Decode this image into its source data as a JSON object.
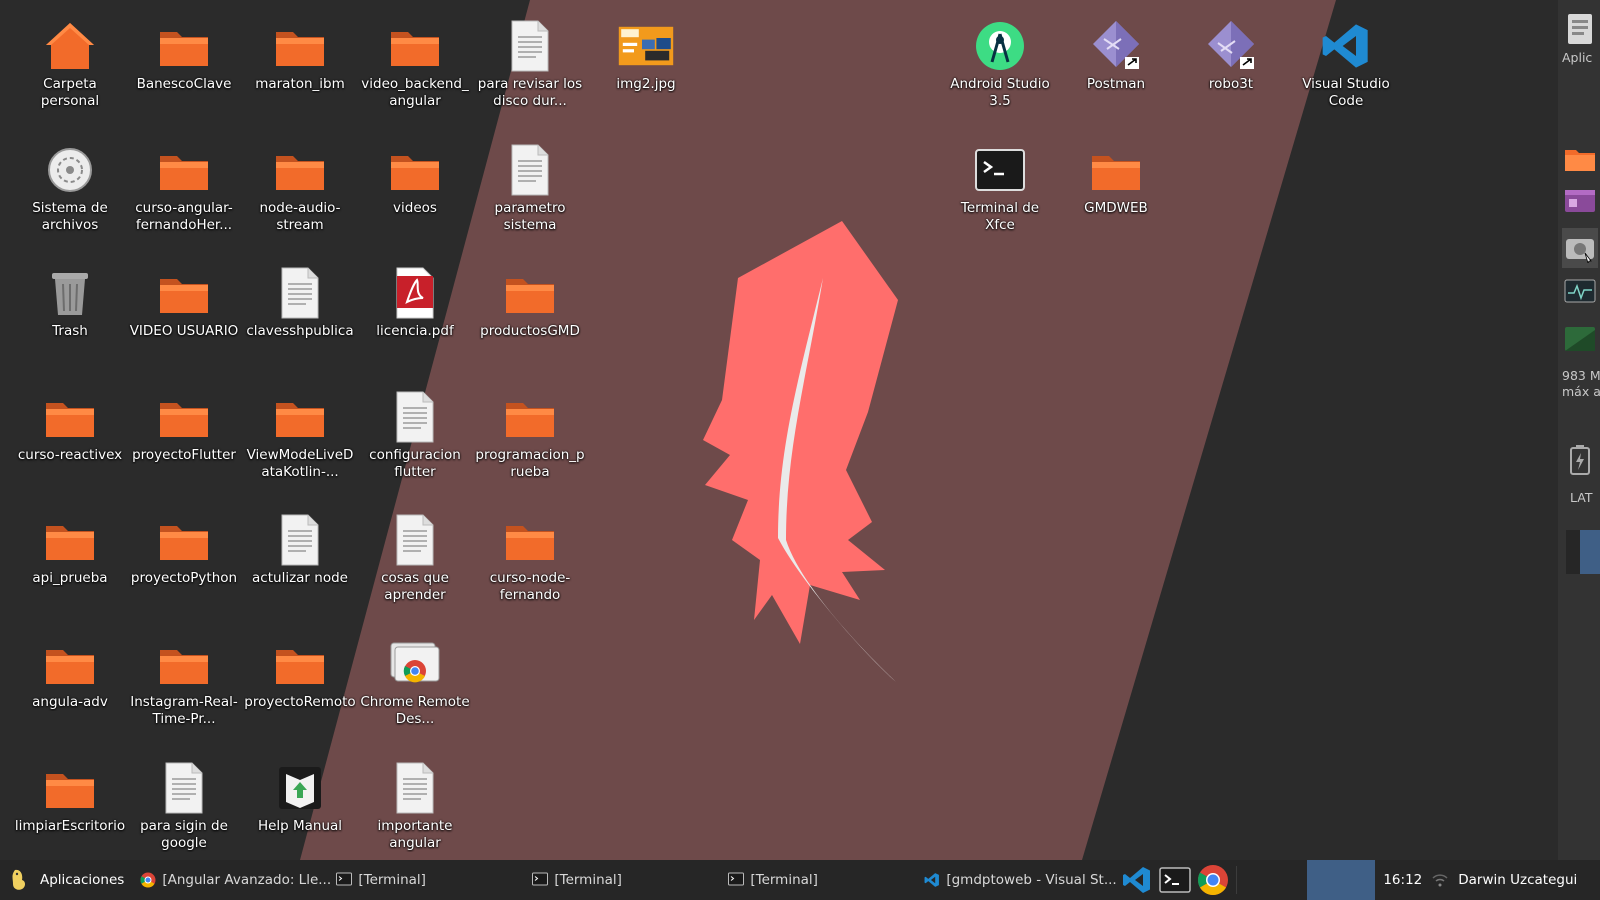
{
  "desktop": {
    "icons": [
      {
        "label": "Carpeta personal",
        "icon": "home-folder-icon"
      },
      {
        "label": "BanescoClave",
        "icon": "folder-icon"
      },
      {
        "label": "maraton_ibm",
        "icon": "folder-icon"
      },
      {
        "label": "video_backend_angular",
        "icon": "folder-icon"
      },
      {
        "label": "para revisar los disco dur...",
        "icon": "text-file-icon"
      },
      {
        "label": "img2.jpg",
        "icon": "image-thumbnail-icon"
      },
      {
        "label": "Sistema de archivos",
        "icon": "filesystem-icon"
      },
      {
        "label": "curso-angular-fernandoHer...",
        "icon": "folder-icon"
      },
      {
        "label": "node-audio-stream",
        "icon": "folder-icon"
      },
      {
        "label": "videos",
        "icon": "folder-icon"
      },
      {
        "label": "parametro sistema",
        "icon": "text-file-icon"
      },
      {
        "label": "Trash",
        "icon": "trash-icon"
      },
      {
        "label": "VIDEO USUARIO",
        "icon": "folder-icon"
      },
      {
        "label": "clavesshpublica",
        "icon": "text-file-icon"
      },
      {
        "label": "licencia.pdf",
        "icon": "pdf-icon"
      },
      {
        "label": "productosGMD",
        "icon": "folder-icon"
      },
      {
        "label": "curso-reactivex",
        "icon": "folder-icon"
      },
      {
        "label": "proyectoFlutter",
        "icon": "folder-icon"
      },
      {
        "label": "ViewModeLiveDataKotlin-...",
        "icon": "folder-icon"
      },
      {
        "label": "configuracion flutter",
        "icon": "text-file-icon"
      },
      {
        "label": "programacion_prueba",
        "icon": "folder-icon"
      },
      {
        "label": "api_prueba",
        "icon": "folder-icon"
      },
      {
        "label": "proyectoPython",
        "icon": "folder-icon"
      },
      {
        "label": "actulizar node",
        "icon": "text-file-icon"
      },
      {
        "label": "cosas que aprender",
        "icon": "text-file-icon"
      },
      {
        "label": "curso-node-fernando",
        "icon": "folder-icon"
      },
      {
        "label": "angula-adv",
        "icon": "folder-icon"
      },
      {
        "label": "Instagram-Real-Time-Pr...",
        "icon": "folder-icon"
      },
      {
        "label": "proyectoRemoto",
        "icon": "folder-icon"
      },
      {
        "label": "Chrome Remote Des...",
        "icon": "chrome-remote-icon"
      },
      {
        "label": "limpiarEscritorio",
        "icon": "folder-icon"
      },
      {
        "label": "para sigin de google",
        "icon": "text-file-icon"
      },
      {
        "label": "Help Manual",
        "icon": "help-manual-icon"
      },
      {
        "label": "importante angular",
        "icon": "text-file-icon"
      },
      {
        "label": "Android Studio 3.5",
        "icon": "android-studio-icon"
      },
      {
        "label": "Postman",
        "icon": "postman-icon"
      },
      {
        "label": "robo3t",
        "icon": "robo3t-icon"
      },
      {
        "label": "Visual Studio Code",
        "icon": "vscode-icon"
      },
      {
        "label": "Terminal de Xfce",
        "icon": "terminal-icon"
      },
      {
        "label": "GMDWEB",
        "icon": "folder-icon"
      }
    ]
  },
  "right_panel": {
    "top_label": "Aplic",
    "memory_line1": "983 M",
    "memory_line2": "máx a",
    "keyboard_layout": "LAT"
  },
  "taskbar": {
    "apps_label": "Aplicaciones",
    "tasks": [
      {
        "label": "[Angular Avanzado: Lle...",
        "icon": "chrome-icon"
      },
      {
        "label": "[Terminal]",
        "icon": "terminal-icon"
      },
      {
        "label": "[Terminal]",
        "icon": "terminal-icon"
      },
      {
        "label": "[Terminal]",
        "icon": "terminal-icon"
      },
      {
        "label": "[gmdptoweb - Visual St...",
        "icon": "vscode-icon"
      }
    ],
    "clock": "16:12",
    "user": "Darwin Uzcategui"
  },
  "colors": {
    "folder": "#f26b2a",
    "wallpaper_band": "#6e4a4a",
    "feather": "#ff6e6c",
    "vscode_blue": "#1f8ad2",
    "android_green": "#3ddc84",
    "postman_purple": "#9b8fd0"
  }
}
